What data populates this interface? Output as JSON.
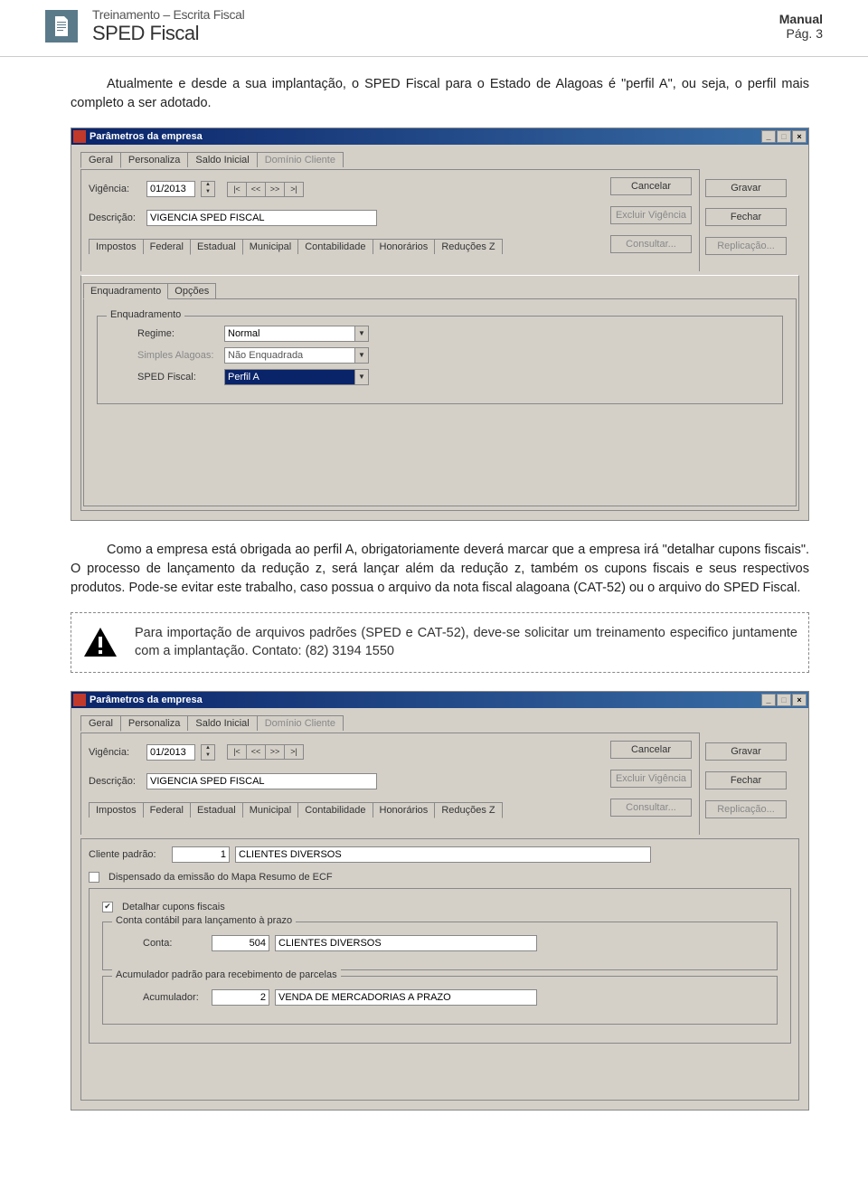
{
  "header": {
    "subtitle": "Treinamento – Escrita Fiscal",
    "title": "SPED Fiscal",
    "manual": "Manual",
    "page": "Pág. 3"
  },
  "para1": "Atualmente e desde a sua implantação, o SPED Fiscal para o Estado de Alagoas é \"perfil A\", ou seja, o perfil mais completo a ser adotado.",
  "win1": {
    "title": "Parâmetros da empresa",
    "tabs_top": [
      "Geral",
      "Personaliza",
      "Saldo Inicial",
      "Domínio Cliente"
    ],
    "vigencia_label": "Vigência:",
    "vigencia_value": "01/2013",
    "nav": [
      "|<",
      "<<",
      ">>",
      ">|"
    ],
    "descricao_label": "Descrição:",
    "descricao_value": "VIGENCIA SPED FISCAL",
    "side": {
      "gravar": "Gravar",
      "fechar": "Fechar",
      "replicacao": "Replicação..."
    },
    "near": {
      "cancelar": "Cancelar",
      "excluir": "Excluir Vigência",
      "consultar": "Consultar..."
    },
    "tabs_mid": [
      "Impostos",
      "Federal",
      "Estadual",
      "Municipal",
      "Contabilidade",
      "Honorários",
      "Reduções Z"
    ],
    "tabs_sub": [
      "Enquadramento",
      "Opções"
    ],
    "group_title": "Enquadramento",
    "regime_label": "Regime:",
    "regime_value": "Normal",
    "simples_label": "Simples Alagoas:",
    "simples_value": "Não Enquadrada",
    "sped_label": "SPED Fiscal:",
    "sped_value": "Perfil A"
  },
  "para2": "Como a empresa está obrigada ao perfil A, obrigatoriamente deverá marcar que a empresa irá \"detalhar cupons fiscais\". O processo de lançamento da redução z, será lançar além da redução z, também os cupons fiscais e seus respectivos produtos. Pode-se evitar este trabalho, caso possua o arquivo da nota fiscal alagoana (CAT-52) ou o arquivo do SPED Fiscal.",
  "alert": "Para importação de arquivos padrões (SPED e CAT-52), deve-se solicitar um treinamento especifico juntamente com a implantação. Contato: (82) 3194 1550",
  "win2": {
    "title": "Parâmetros da empresa",
    "tabs_top": [
      "Geral",
      "Personaliza",
      "Saldo Inicial",
      "Domínio Cliente"
    ],
    "vigencia_label": "Vigência:",
    "vigencia_value": "01/2013",
    "nav": [
      "|<",
      "<<",
      ">>",
      ">|"
    ],
    "descricao_label": "Descrição:",
    "descricao_value": "VIGENCIA SPED FISCAL",
    "side": {
      "gravar": "Gravar",
      "fechar": "Fechar",
      "replicacao": "Replicação..."
    },
    "near": {
      "cancelar": "Cancelar",
      "excluir": "Excluir Vigência",
      "consultar": "Consultar..."
    },
    "tabs_mid": [
      "Impostos",
      "Federal",
      "Estadual",
      "Municipal",
      "Contabilidade",
      "Honorários",
      "Reduções Z"
    ],
    "cliente_label": "Cliente padrão:",
    "cliente_num": "1",
    "cliente_name": "CLIENTES DIVERSOS",
    "chk_dispensado": "Dispensado da emissão do Mapa Resumo de ECF",
    "chk_detalhar": "Detalhar cupons fiscais",
    "group_conta_title": "Conta contábil para lançamento à prazo",
    "conta_label": "Conta:",
    "conta_num": "504",
    "conta_name": "CLIENTES DIVERSOS",
    "group_acum_title": "Acumulador padrão para recebimento de parcelas",
    "acum_label": "Acumulador:",
    "acum_num": "2",
    "acum_name": "VENDA DE MERCADORIAS A PRAZO"
  }
}
